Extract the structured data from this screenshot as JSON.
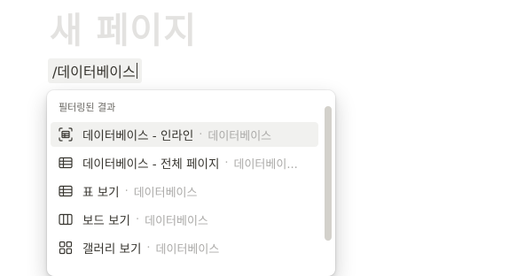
{
  "page": {
    "title": "새 페이지"
  },
  "editor": {
    "slash_command": "/데이터베이스"
  },
  "menu": {
    "header": "필터링된 결과",
    "items": [
      {
        "label": "데이터베이스 - 인라인",
        "sub": "데이터베이스",
        "icon": "database-inline-icon"
      },
      {
        "label": "데이터베이스 - 전체 페이지",
        "sub": "데이터베이...",
        "icon": "table-icon"
      },
      {
        "label": "표 보기",
        "sub": "데이터베이스",
        "icon": "table-icon"
      },
      {
        "label": "보드 보기",
        "sub": "데이터베이스",
        "icon": "board-icon"
      },
      {
        "label": "갤러리 보기",
        "sub": "데이터베이스",
        "icon": "gallery-icon"
      }
    ],
    "separator": "·"
  }
}
